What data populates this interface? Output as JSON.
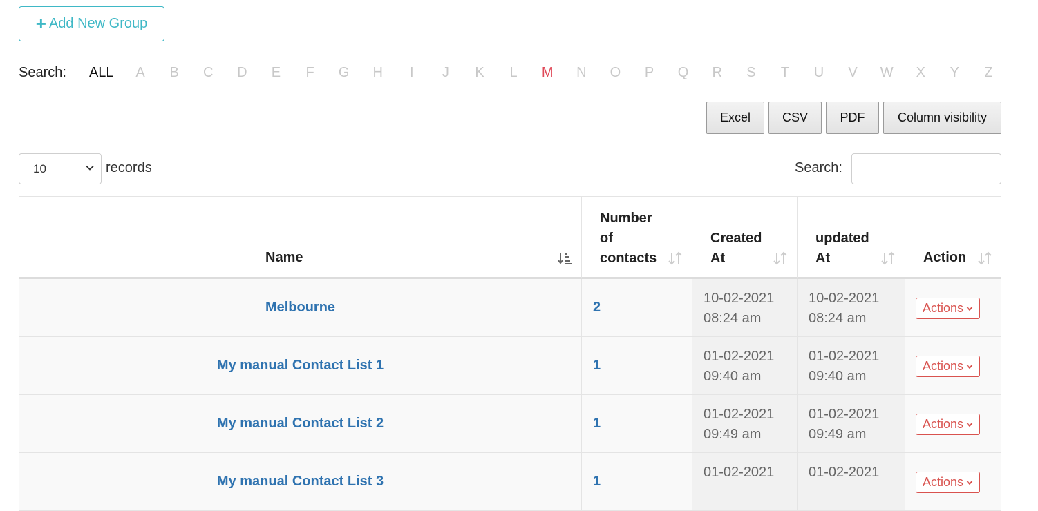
{
  "add_group": {
    "label": "Add New Group"
  },
  "alphabet": {
    "label": "Search:",
    "all": "ALL",
    "letters": [
      "A",
      "B",
      "C",
      "D",
      "E",
      "F",
      "G",
      "H",
      "I",
      "J",
      "K",
      "L",
      "M",
      "N",
      "O",
      "P",
      "Q",
      "R",
      "S",
      "T",
      "U",
      "V",
      "W",
      "X",
      "Y",
      "Z"
    ],
    "active": "M"
  },
  "export_buttons": [
    "Excel",
    "CSV",
    "PDF",
    "Column visibility"
  ],
  "length": {
    "value": "10",
    "suffix": "records"
  },
  "search": {
    "label": "Search:",
    "value": ""
  },
  "table": {
    "headers": {
      "name": "Name",
      "contacts": [
        "Number",
        "of",
        "contacts"
      ],
      "created": [
        "Created",
        "At"
      ],
      "updated": [
        "updated",
        "At"
      ],
      "action": "Action"
    },
    "rows": [
      {
        "name": "Melbourne",
        "contacts": "2",
        "created": [
          "10-02-2021",
          "08:24 am"
        ],
        "updated": [
          "10-02-2021",
          "08:24 am"
        ],
        "action": "Actions"
      },
      {
        "name": "My manual Contact List 1",
        "contacts": "1",
        "created": [
          "01-02-2021",
          "09:40 am"
        ],
        "updated": [
          "01-02-2021",
          "09:40 am"
        ],
        "action": "Actions"
      },
      {
        "name": "My manual Contact List 2",
        "contacts": "1",
        "created": [
          "01-02-2021",
          "09:49 am"
        ],
        "updated": [
          "01-02-2021",
          "09:49 am"
        ],
        "action": "Actions"
      },
      {
        "name": "My manual Contact List 3",
        "contacts": "1",
        "created": [
          "01-02-2021",
          ""
        ],
        "updated": [
          "01-02-2021",
          ""
        ],
        "action": "Actions"
      }
    ]
  },
  "colors": {
    "accent": "#3fb8c6",
    "link": "#2f73b0",
    "active_letter": "#e04a59",
    "danger": "#d9534f"
  }
}
